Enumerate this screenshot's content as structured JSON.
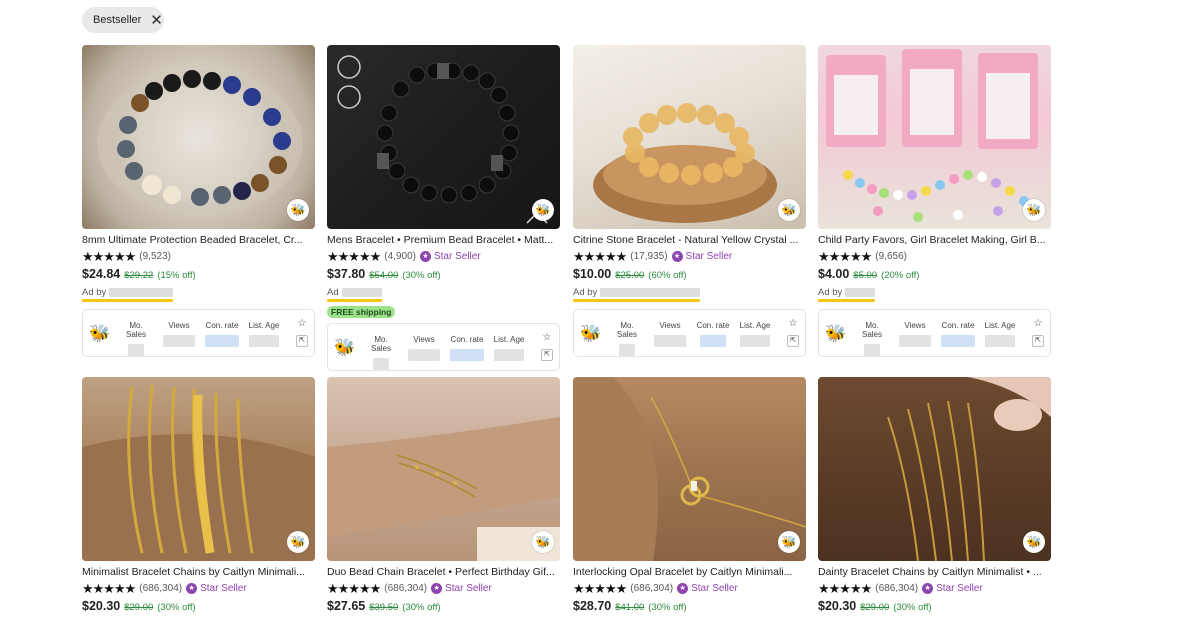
{
  "filter_chip": {
    "label": "Bestseller",
    "close_icon": "close-icon"
  },
  "stats_labels": {
    "sales": "Mo. Sales",
    "views": "Views",
    "conv": "Con. rate",
    "age": "List. Age"
  },
  "row1": [
    {
      "title": "8mm Ultimate Protection Beaded Bracelet, Cr...",
      "stars": "★★★★★",
      "count": "(9,523)",
      "star_seller": "",
      "price": "$24.84",
      "orig": "$29.22",
      "off": "(15% off)",
      "ad": "Ad by",
      "free_shipping": ""
    },
    {
      "title": "Mens Bracelet • Premium Bead Bracelet • Matt...",
      "stars": "★★★★★",
      "count": "(4,900)",
      "star_seller": "Star Seller",
      "price": "$37.80",
      "orig": "$54.00",
      "off": "(30% off)",
      "ad": "Ad",
      "free_shipping": "FREE shipping"
    },
    {
      "title": "Citrine Stone Bracelet - Natural Yellow Crystal ...",
      "stars": "★★★★★",
      "count": "(17,935)",
      "star_seller": "Star Seller",
      "price": "$10.00",
      "orig": "$25.00",
      "off": "(60% off)",
      "ad": "Ad by",
      "free_shipping": ""
    },
    {
      "title": "Child Party Favors, Girl Bracelet Making, Girl B...",
      "stars": "★★★★★",
      "count": "(9,656)",
      "star_seller": "",
      "price": "$4.00",
      "orig": "$5.00",
      "off": "(20% off)",
      "ad": "Ad by",
      "free_shipping": ""
    }
  ],
  "row2": [
    {
      "title": "Minimalist Bracelet Chains by Caitlyn Minimali...",
      "stars": "★★★★★",
      "count": "(686,304)",
      "star_seller": "Star Seller",
      "price": "$20.30",
      "orig": "$29.00",
      "off": "(30% off)"
    },
    {
      "title": "Duo Bead Chain Bracelet • Perfect Birthday Gif...",
      "stars": "★★★★★",
      "count": "(686,304)",
      "star_seller": "Star Seller",
      "price": "$27.65",
      "orig": "$39.50",
      "off": "(30% off)"
    },
    {
      "title": "Interlocking Opal Bracelet by Caitlyn Minimali...",
      "stars": "★★★★★",
      "count": "(686,304)",
      "star_seller": "Star Seller",
      "price": "$28.70",
      "orig": "$41.00",
      "off": "(30% off)"
    },
    {
      "title": "Dainty Bracelet Chains by Caitlyn Minimalist • ...",
      "stars": "★★★★★",
      "count": "(686,304)",
      "star_seller": "Star Seller",
      "price": "$20.30",
      "orig": "$29.00",
      "off": "(30% off)"
    }
  ]
}
